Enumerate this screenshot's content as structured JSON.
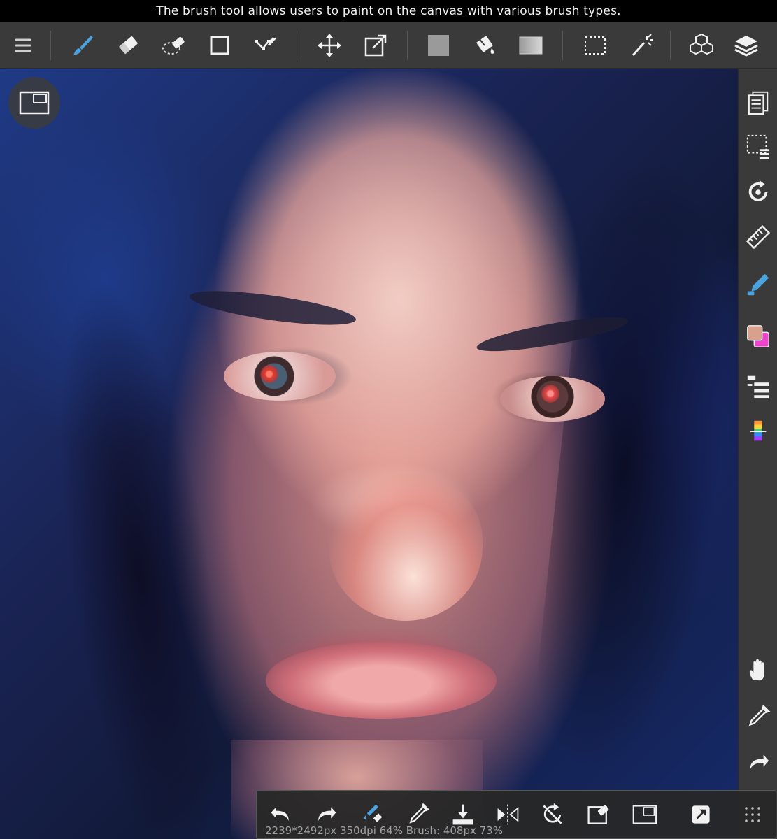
{
  "tooltip": {
    "text": "The brush tool allows users to paint on the canvas with various brush types."
  },
  "toolbar": {
    "items": [
      "menu-icon",
      "brush-icon",
      "eraser-icon",
      "smudge-icon",
      "rectangle-icon",
      "polyline-icon",
      "move-icon",
      "transform-icon",
      "fill-color-icon",
      "bucket-icon",
      "gradient-icon",
      "select-icon",
      "magic-wand-icon",
      "3d-icon",
      "layers-icon"
    ],
    "active_tool": "brush",
    "accent_color": "#4aa3df",
    "fill_swatch_color": "#9a9a9a"
  },
  "sidebar": {
    "items": [
      "pages-icon",
      "selection-list-icon",
      "rotate-icon",
      "ruler-icon",
      "pen-icon",
      "color-swatch-icon",
      "materials-icon",
      "color-balance-icon",
      "hand-icon",
      "eyedropper-icon",
      "redo-icon"
    ],
    "primary_color": "#d9a18c",
    "secondary_color": "#ee44cc"
  },
  "bottom_bar": {
    "status": "2239*2492px 350dpi 64% Brush: 408px 73%",
    "items": [
      "undo-icon",
      "redo-icon",
      "brush-swap-icon",
      "eyedropper-icon",
      "save-icon",
      "flip-icon",
      "rotate-reset-icon",
      "clear-icon",
      "view-icon",
      "share-icon",
      "grid-icon"
    ]
  }
}
